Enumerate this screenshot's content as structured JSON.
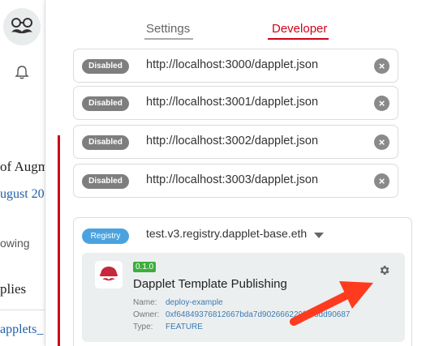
{
  "background_page": {
    "line1": "of Augm",
    "line2": "ugust 20",
    "line3": "owing",
    "line4": "plies",
    "line5": "applets_"
  },
  "tabs": [
    {
      "label": "Settings",
      "active": false
    },
    {
      "label": "Developer",
      "active": true
    }
  ],
  "providers": [
    {
      "status": "Disabled",
      "url": "http://localhost:3000/dapplet.json"
    },
    {
      "status": "Disabled",
      "url": "http://localhost:3001/dapplet.json"
    },
    {
      "status": "Disabled",
      "url": "http://localhost:3002/dapplet.json"
    },
    {
      "status": "Disabled",
      "url": "http://localhost:3003/dapplet.json"
    }
  ],
  "registry": {
    "badge": "Registry",
    "name": "test.v3.registry.dapplet-base.eth",
    "dapplet": {
      "version": "0.1.0",
      "title": "Dapplet Template Publishing",
      "name_label": "Name:",
      "name_value": "deploy-example",
      "owner_label": "Owner:",
      "owner_value": "0xf64849376812667bda7d902666229f8b8dd90687",
      "type_label": "Type:",
      "type_value": "FEATURE"
    }
  },
  "colors": {
    "accent": "#d0021b",
    "registry_badge": "#4aa3df",
    "version_badge": "#3cae3c",
    "arrow": "#ff3b1f"
  },
  "icons": [
    "mustache-avatar-icon",
    "bell-icon",
    "close-icon",
    "dropdown-caret-icon",
    "gear-icon",
    "dapplet-logo-icon",
    "arrow-annotation"
  ]
}
